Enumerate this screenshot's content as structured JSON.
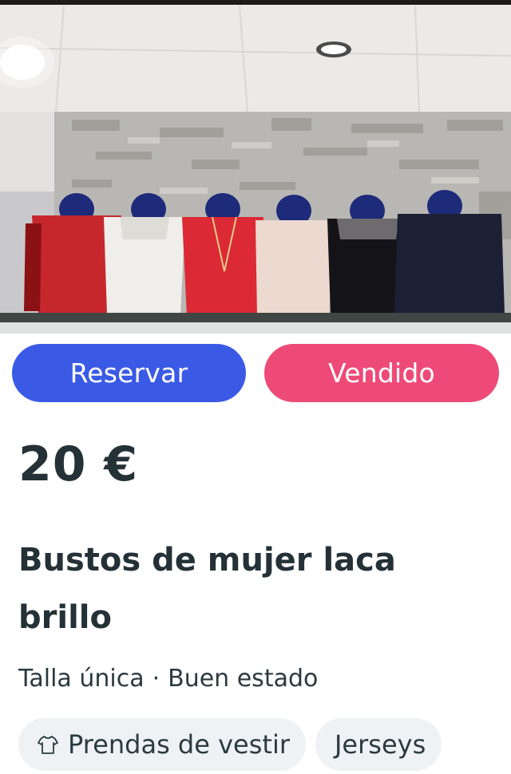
{
  "listing": {
    "photo_alt": "Bustos de mujer laca brillo",
    "price": "20 €",
    "title": "Bustos de mujer laca brillo",
    "size": "Talla única",
    "separator": "·",
    "condition": "Buen estado"
  },
  "actions": {
    "reserve_label": "Reservar",
    "sold_label": "Vendido"
  },
  "categories": [
    {
      "label": "Prendas de vestir",
      "icon": "shirt-icon"
    },
    {
      "label": "Jerseys"
    }
  ],
  "colors": {
    "reserve": "#3a5ae6",
    "sold": "#ee4a78",
    "text": "#243137",
    "chip_bg": "#eef2f4"
  }
}
